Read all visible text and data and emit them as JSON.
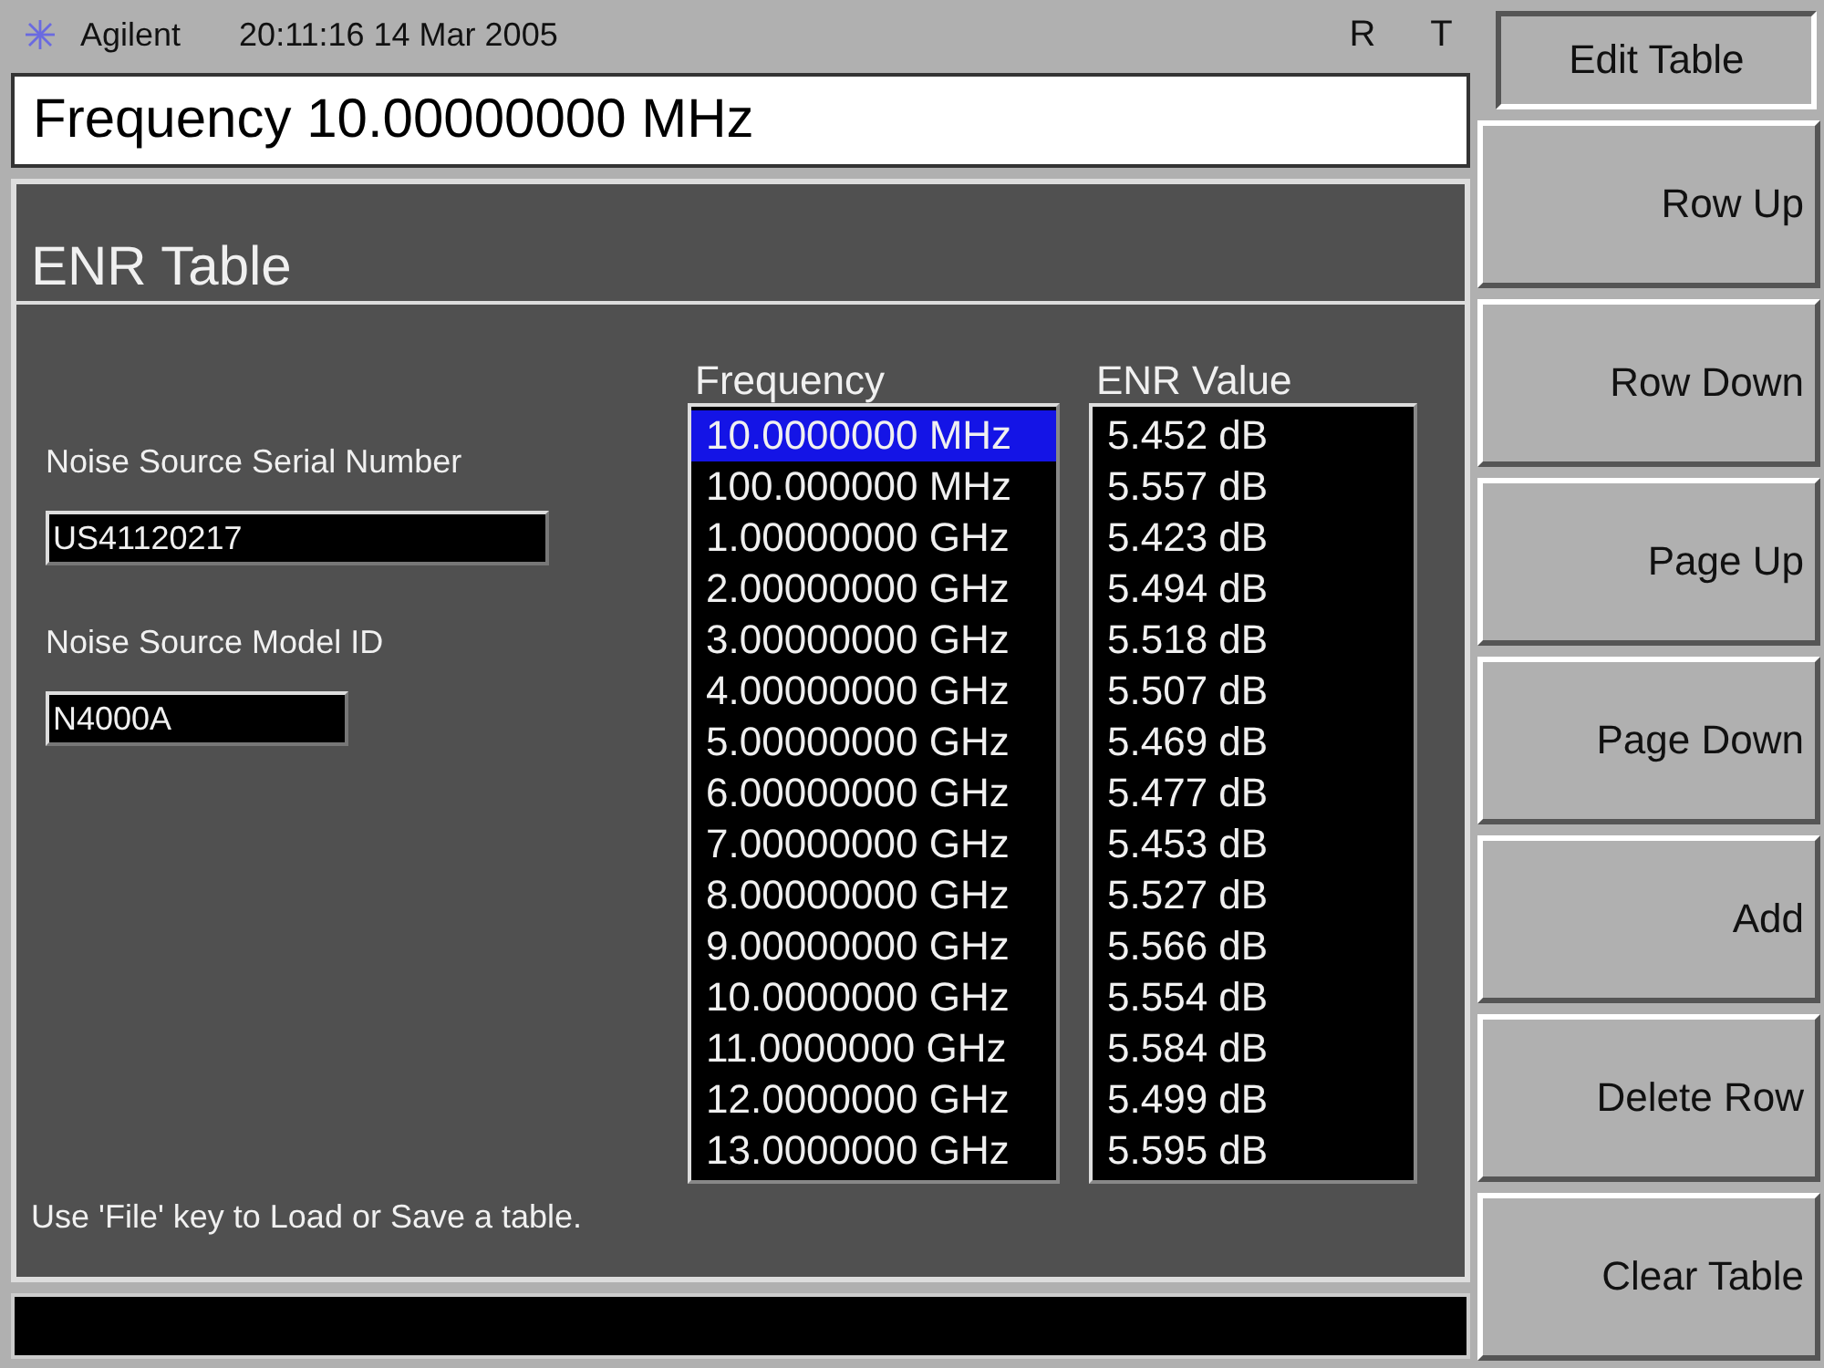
{
  "status_bar": {
    "brand": "Agilent",
    "datetime": "20:11:16  14 Mar 2005",
    "indicators": [
      "R",
      "T"
    ]
  },
  "active_parameter": "Frequency 10.00000000 MHz",
  "panel": {
    "title": "ENR Table",
    "fields": [
      {
        "label": "Noise Source Serial Number",
        "value": "US41120217",
        "wide": true
      },
      {
        "label": "Noise Source Model ID",
        "value": "N4000A",
        "wide": false
      }
    ],
    "columns": [
      "Frequency",
      "ENR Value"
    ],
    "rows": [
      {
        "frequency": "10.0000000 MHz",
        "enr": "5.452 dB",
        "selected": true
      },
      {
        "frequency": "100.000000 MHz",
        "enr": "5.557 dB",
        "selected": false
      },
      {
        "frequency": "1.00000000 GHz",
        "enr": "5.423 dB",
        "selected": false
      },
      {
        "frequency": "2.00000000 GHz",
        "enr": "5.494 dB",
        "selected": false
      },
      {
        "frequency": "3.00000000 GHz",
        "enr": "5.518 dB",
        "selected": false
      },
      {
        "frequency": "4.00000000 GHz",
        "enr": "5.507 dB",
        "selected": false
      },
      {
        "frequency": "5.00000000 GHz",
        "enr": "5.469 dB",
        "selected": false
      },
      {
        "frequency": "6.00000000 GHz",
        "enr": "5.477 dB",
        "selected": false
      },
      {
        "frequency": "7.00000000 GHz",
        "enr": "5.453 dB",
        "selected": false
      },
      {
        "frequency": "8.00000000 GHz",
        "enr": "5.527 dB",
        "selected": false
      },
      {
        "frequency": "9.00000000 GHz",
        "enr": "5.566 dB",
        "selected": false
      },
      {
        "frequency": "10.0000000 GHz",
        "enr": "5.554 dB",
        "selected": false
      },
      {
        "frequency": "11.0000000 GHz",
        "enr": "5.584 dB",
        "selected": false
      },
      {
        "frequency": "12.0000000 GHz",
        "enr": "5.499 dB",
        "selected": false
      },
      {
        "frequency": "13.0000000 GHz",
        "enr": "5.595 dB",
        "selected": false
      }
    ],
    "hint": "Use 'File' key to Load or Save a table."
  },
  "menu": {
    "title": "Edit Table",
    "softkeys": [
      "Row Up",
      "Row Down",
      "Page Up",
      "Page Down",
      "Add",
      "Delete Row",
      "Clear Table"
    ]
  }
}
